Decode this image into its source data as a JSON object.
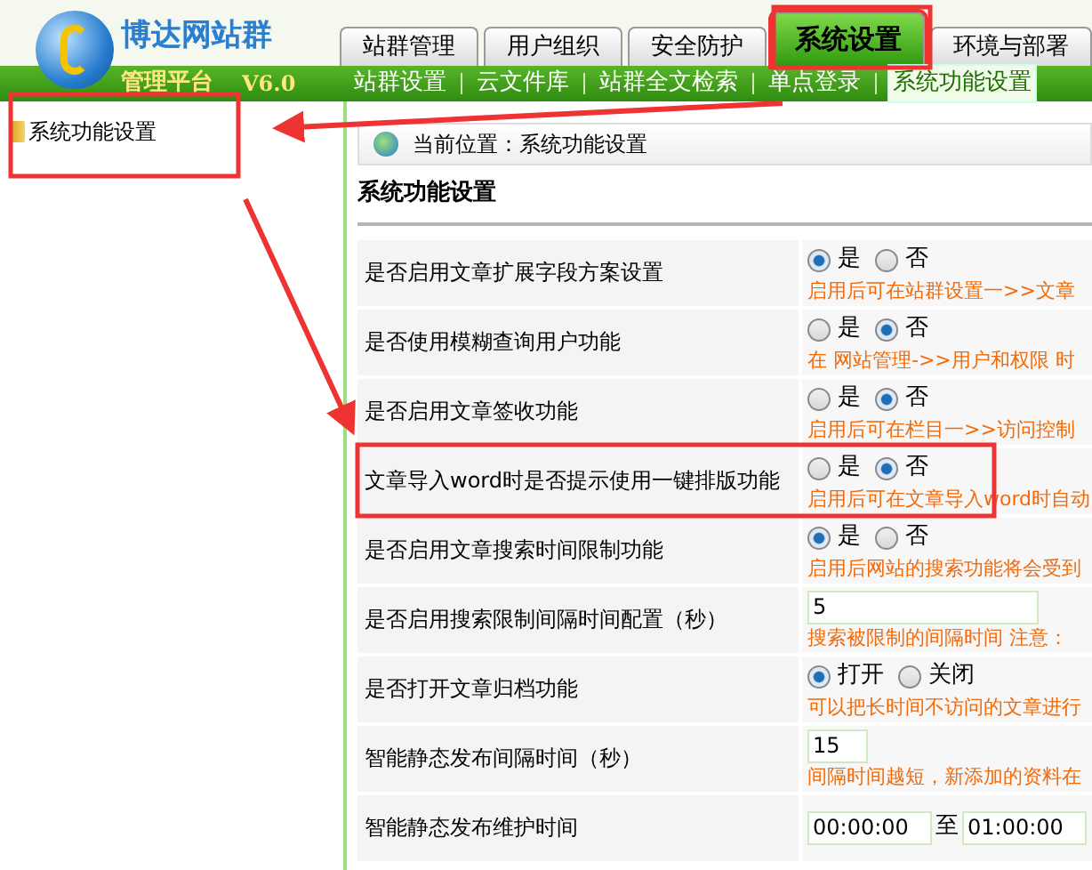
{
  "logo": {
    "name": "博达网站群",
    "subtitle": "管理平台",
    "version": "V6.0"
  },
  "tabs": [
    {
      "label": "站群管理",
      "selected": false
    },
    {
      "label": "用户组织",
      "selected": false
    },
    {
      "label": "安全防护",
      "selected": false
    },
    {
      "label": "系统设置",
      "selected": true
    },
    {
      "label": "环境与部署",
      "selected": false
    }
  ],
  "subnav": [
    {
      "label": "站群设置",
      "selected": false
    },
    {
      "label": "云文件库",
      "selected": false
    },
    {
      "label": "站群全文检索",
      "selected": false
    },
    {
      "label": "单点登录",
      "selected": false
    },
    {
      "label": "系统功能设置",
      "selected": true
    }
  ],
  "sidebar": {
    "items": [
      {
        "label": "系统功能设置"
      }
    ]
  },
  "breadcrumb": "当前位置：系统功能设置",
  "section_title": "系统功能设置",
  "rows": [
    {
      "kind": "radio",
      "label": "是否启用文章扩展字段方案设置",
      "options": [
        {
          "label": "是",
          "selected": true
        },
        {
          "label": "否",
          "selected": false
        }
      ],
      "hint": "启用后可在站群设置一>>文章"
    },
    {
      "kind": "radio",
      "label": "是否使用模糊查询用户功能",
      "options": [
        {
          "label": "是",
          "selected": false
        },
        {
          "label": "否",
          "selected": true
        }
      ],
      "hint": "在 网站管理->>用户和权限 时"
    },
    {
      "kind": "radio",
      "label": "是否启用文章签收功能",
      "options": [
        {
          "label": "是",
          "selected": false
        },
        {
          "label": "否",
          "selected": true
        }
      ],
      "hint": "启用后可在栏目一>>访问控制"
    },
    {
      "kind": "radio",
      "label": "文章导入word时是否提示使用一键排版功能",
      "options": [
        {
          "label": "是",
          "selected": false
        },
        {
          "label": "否",
          "selected": true
        }
      ],
      "hint": "启用后可在文章导入word时自动"
    },
    {
      "kind": "radio",
      "label": "是否启用文章搜索时间限制功能",
      "options": [
        {
          "label": "是",
          "selected": true
        },
        {
          "label": "否",
          "selected": false
        }
      ],
      "hint": "启用后网站的搜索功能将会受到"
    },
    {
      "kind": "input",
      "label": "是否启用搜索限制间隔时间配置（秒）",
      "value": "5",
      "hint": "搜索被限制的间隔时间 注意："
    },
    {
      "kind": "radio",
      "label": "是否打开文章归档功能",
      "options": [
        {
          "label": "打开",
          "selected": true
        },
        {
          "label": "关闭",
          "selected": false
        }
      ],
      "hint": "可以把长时间不访问的文章进行"
    },
    {
      "kind": "short_input",
      "label": "智能静态发布间隔时间（秒）",
      "value": "15",
      "hint": "间隔时间越短，新添加的资料在"
    },
    {
      "kind": "range",
      "label": "智能静态发布维护时间",
      "from": "00:00:00",
      "separator": "至",
      "to": "01:00:00"
    }
  ]
}
